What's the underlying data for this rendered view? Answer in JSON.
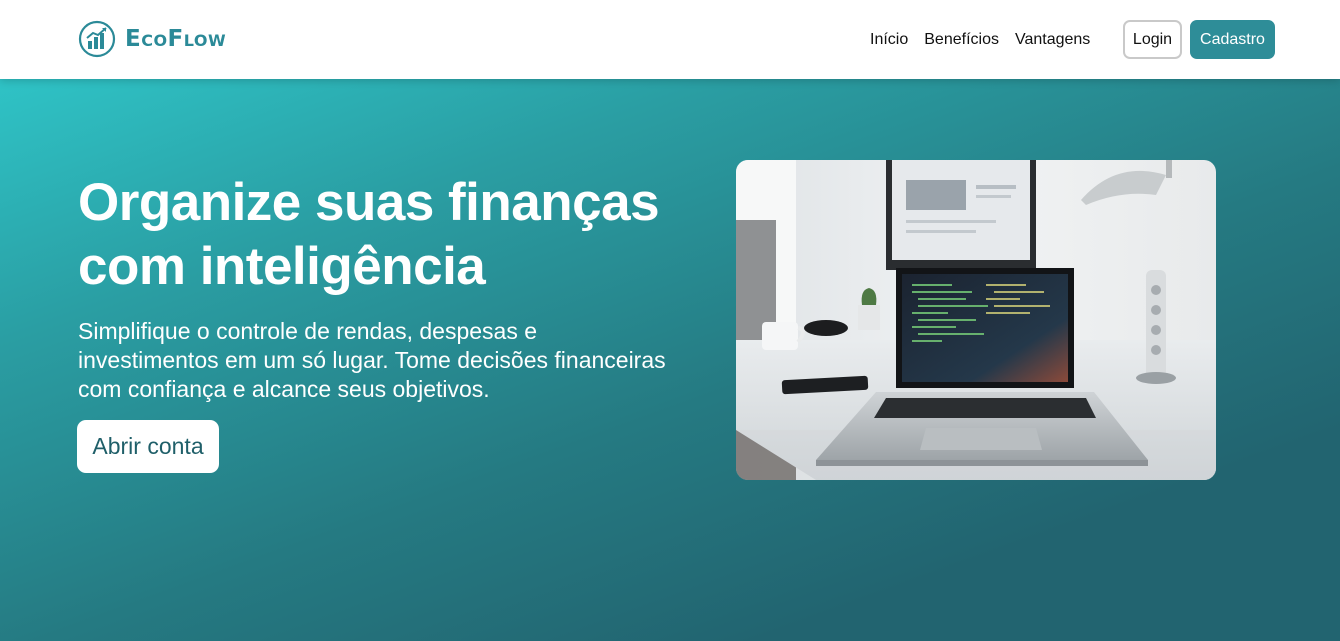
{
  "brand": {
    "name": "EcoFlow",
    "color": "#2b8a98"
  },
  "nav": {
    "links": [
      "Início",
      "Benefícios",
      "Vantagens"
    ],
    "login_label": "Login",
    "signup_label": "Cadastro"
  },
  "hero": {
    "title": "Organize suas finanças com inteligência",
    "subtitle": "Simplifique o controle de rendas, despesas e investimentos em um só lugar. Tome decisões financeiras com confiança e alcance seus objetivos.",
    "cta_label": "Abrir conta",
    "image_icon": "laptop-workspace-photo"
  },
  "colors": {
    "accent": "#2e8d98",
    "hero_gradient_start": "#2fc3c6",
    "hero_gradient_end": "#226470"
  }
}
